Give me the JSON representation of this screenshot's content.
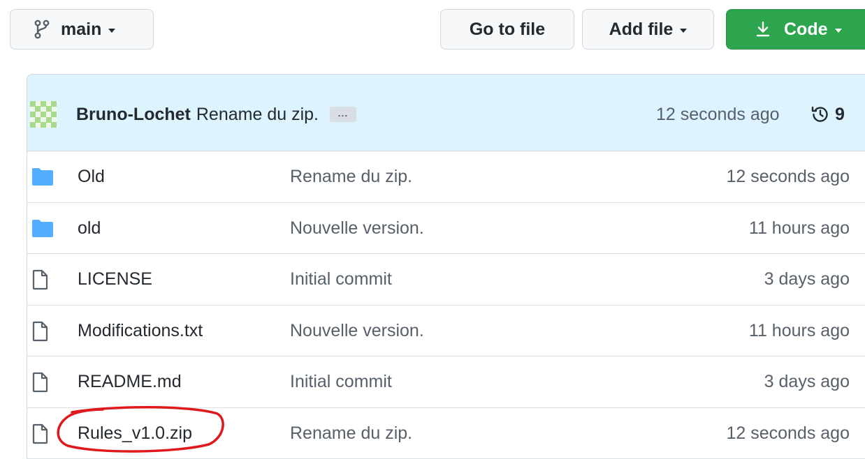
{
  "toolbar": {
    "branch_label": "main",
    "go_to_file_label": "Go to file",
    "add_file_label": "Add file",
    "code_label": "Code"
  },
  "commit": {
    "author": "Bruno-Lochet",
    "message": "Rename du zip.",
    "ellipsis": "...",
    "time": "12 seconds ago",
    "history_count": "9"
  },
  "files": [
    {
      "type": "folder",
      "icon": "folder-icon",
      "name": "Old",
      "message": "Rename du zip.",
      "age": "12 seconds ago"
    },
    {
      "type": "folder",
      "icon": "folder-icon",
      "name": "old",
      "message": "Nouvelle version.",
      "age": "11 hours ago"
    },
    {
      "type": "file",
      "icon": "file-icon",
      "name": "LICENSE",
      "message": "Initial commit",
      "age": "3 days ago"
    },
    {
      "type": "file",
      "icon": "file-icon",
      "name": "Modifications.txt",
      "message": "Nouvelle version.",
      "age": "11 hours ago"
    },
    {
      "type": "file",
      "icon": "file-icon",
      "name": "README.md",
      "message": "Initial commit",
      "age": "3 days ago"
    },
    {
      "type": "file",
      "icon": "file-icon",
      "name": "Rules_v1.0.zip",
      "message": "Rename du zip.",
      "age": "12 seconds ago"
    }
  ],
  "colors": {
    "primary_button": "#2da44e",
    "commit_bar_bg": "#ddf4ff",
    "folder_icon": "#54aeff",
    "annotation": "#e0191c"
  }
}
